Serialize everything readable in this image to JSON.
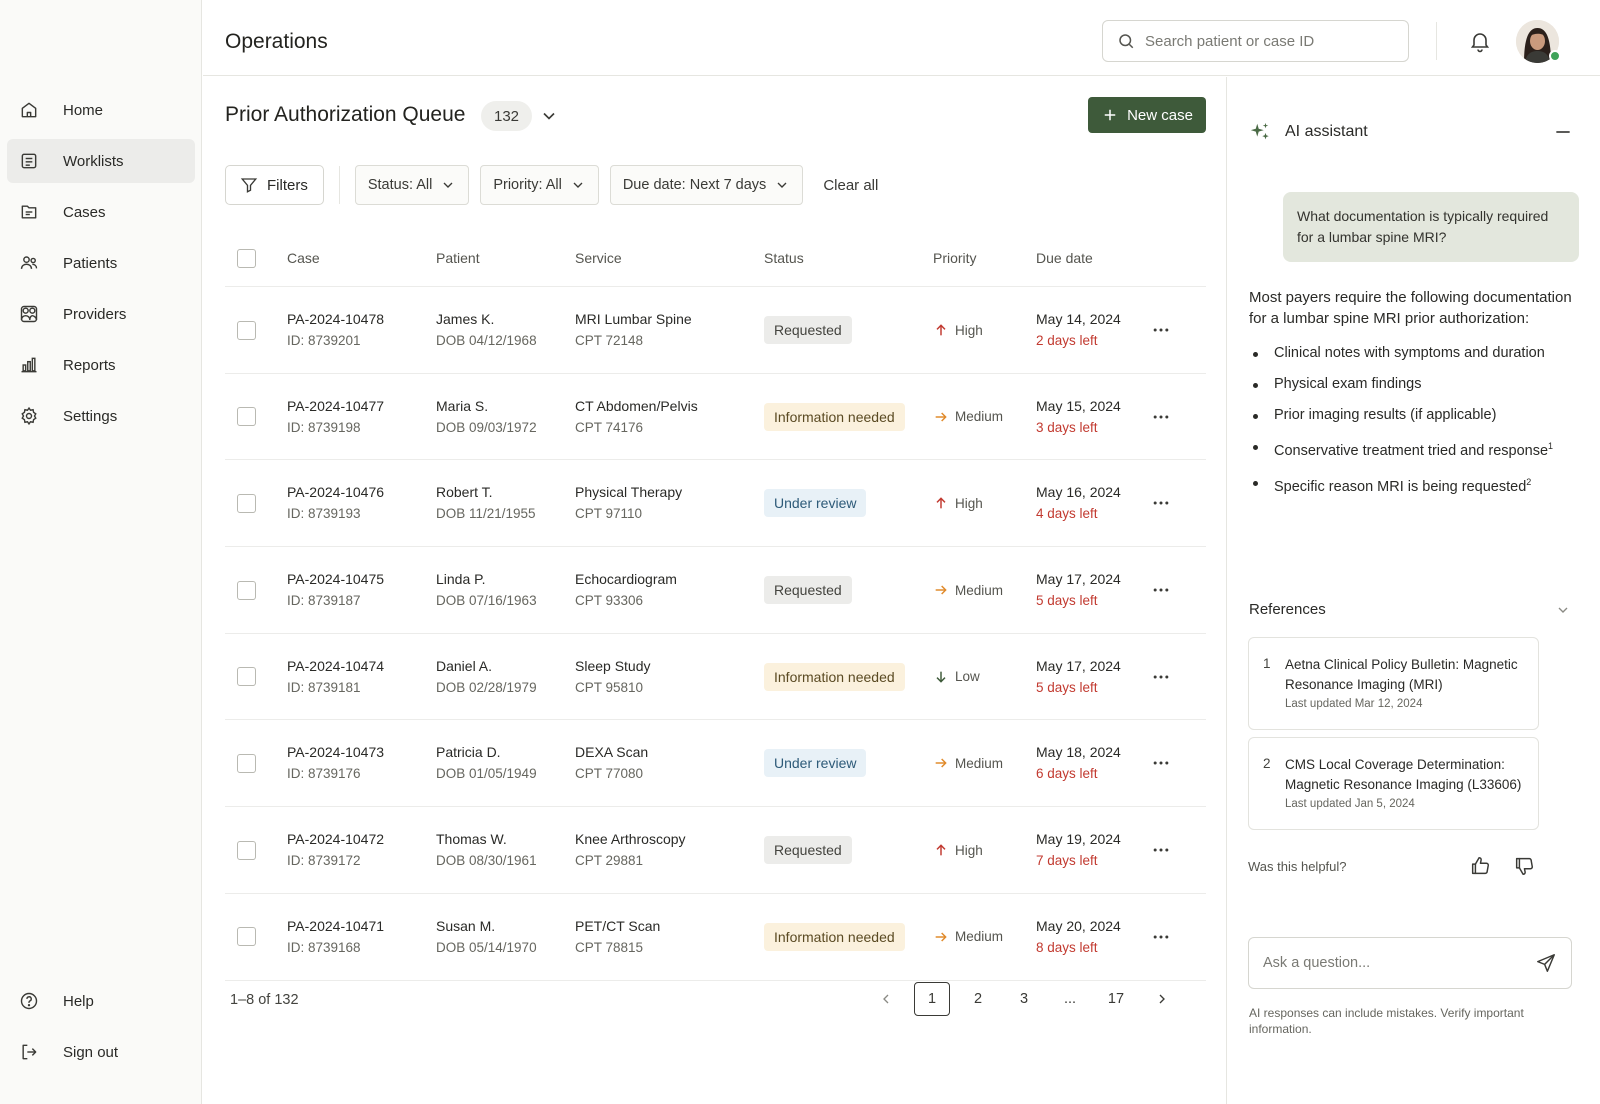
{
  "sidebar": {
    "items": [
      {
        "label": "Home",
        "icon": "home-icon"
      },
      {
        "label": "Worklists",
        "icon": "worklist-icon",
        "active": true
      },
      {
        "label": "Cases",
        "icon": "folder-icon"
      },
      {
        "label": "Patients",
        "icon": "users-icon"
      },
      {
        "label": "Providers",
        "icon": "providers-icon"
      },
      {
        "label": "Reports",
        "icon": "chart-icon"
      },
      {
        "label": "Settings",
        "icon": "gear-icon"
      }
    ],
    "bottom": [
      {
        "label": "Help",
        "icon": "help-icon"
      },
      {
        "label": "Sign out",
        "icon": "sign-out-icon"
      }
    ]
  },
  "header": {
    "title": "Operations",
    "search_placeholder": "Search patient or case ID"
  },
  "queue": {
    "title": "Prior Authorization Queue",
    "count": "132",
    "new_case_label": "New case"
  },
  "filters": {
    "filters_label": "Filters",
    "status": "Status: All",
    "priority": "Priority: All",
    "due_date": "Due date: Next 7 days",
    "clear_all": "Clear all"
  },
  "table": {
    "columns": [
      "Case",
      "Patient",
      "Service",
      "Status",
      "Priority",
      "Due date"
    ],
    "rows": [
      {
        "case": "PA-2024-10478",
        "id": "ID: 8739201",
        "patient": "James K.",
        "dob": "DOB 04/12/1968",
        "service": "MRI Lumbar Spine",
        "cpt": "CPT 72148",
        "status": "Requested",
        "status_type": "requested",
        "priority": "High",
        "priority_type": "high",
        "due": "May 14, 2024",
        "left": "2 days left"
      },
      {
        "case": "PA-2024-10477",
        "id": "ID: 8739198",
        "patient": "Maria S.",
        "dob": "DOB 09/03/1972",
        "service": "CT Abdomen/Pelvis",
        "cpt": "CPT 74176",
        "status": "Information needed",
        "status_type": "info",
        "priority": "Medium",
        "priority_type": "medium",
        "due": "May 15, 2024",
        "left": "3 days left"
      },
      {
        "case": "PA-2024-10476",
        "id": "ID: 8739193",
        "patient": "Robert T.",
        "dob": "DOB 11/21/1955",
        "service": "Physical Therapy",
        "cpt": "CPT 97110",
        "status": "Under review",
        "status_type": "review",
        "priority": "High",
        "priority_type": "high",
        "due": "May 16, 2024",
        "left": "4 days left"
      },
      {
        "case": "PA-2024-10475",
        "id": "ID: 8739187",
        "patient": "Linda P.",
        "dob": "DOB 07/16/1963",
        "service": "Echocardiogram",
        "cpt": "CPT 93306",
        "status": "Requested",
        "status_type": "requested",
        "priority": "Medium",
        "priority_type": "medium",
        "due": "May 17, 2024",
        "left": "5 days left"
      },
      {
        "case": "PA-2024-10474",
        "id": "ID: 8739181",
        "patient": "Daniel A.",
        "dob": "DOB 02/28/1979",
        "service": "Sleep Study",
        "cpt": "CPT 95810",
        "status": "Information needed",
        "status_type": "info",
        "priority": "Low",
        "priority_type": "low",
        "due": "May 17, 2024",
        "left": "5 days left"
      },
      {
        "case": "PA-2024-10473",
        "id": "ID: 8739176",
        "patient": "Patricia D.",
        "dob": "DOB 01/05/1949",
        "service": "DEXA Scan",
        "cpt": "CPT 77080",
        "status": "Under review",
        "status_type": "review",
        "priority": "Medium",
        "priority_type": "medium",
        "due": "May 18, 2024",
        "left": "6 days left"
      },
      {
        "case": "PA-2024-10472",
        "id": "ID: 8739172",
        "patient": "Thomas W.",
        "dob": "DOB 08/30/1961",
        "service": "Knee Arthroscopy",
        "cpt": "CPT 29881",
        "status": "Requested",
        "status_type": "requested",
        "priority": "High",
        "priority_type": "high",
        "due": "May 19, 2024",
        "left": "7 days left"
      },
      {
        "case": "PA-2024-10471",
        "id": "ID: 8739168",
        "patient": "Susan M.",
        "dob": "DOB 05/14/1970",
        "service": "PET/CT Scan",
        "cpt": "CPT 78815",
        "status": "Information needed",
        "status_type": "info",
        "priority": "Medium",
        "priority_type": "medium",
        "due": "May 20, 2024",
        "left": "8 days left"
      }
    ]
  },
  "pagination": {
    "summary": "1–8 of 132",
    "pages": [
      "1",
      "2",
      "3",
      "...",
      "17"
    ],
    "current": "1"
  },
  "assistant": {
    "title": "AI assistant",
    "question": "What documentation is typically required for a lumbar spine MRI?",
    "answer_intro": "Most payers require the following documentation for a lumbar spine MRI prior authorization:",
    "bullets": [
      {
        "text": "Clinical notes with symptoms and duration",
        "sup": ""
      },
      {
        "text": "Physical exam findings",
        "sup": ""
      },
      {
        "text": "Prior imaging results (if applicable)",
        "sup": ""
      },
      {
        "text": "Conservative treatment tried and response",
        "sup": "1"
      },
      {
        "text": "Specific reason MRI is being requested",
        "sup": "2"
      }
    ],
    "references_label": "References",
    "references": [
      {
        "num": "1",
        "title": "Aetna Clinical Policy Bulletin: Magnetic Resonance Imaging (MRI)",
        "date": "Last updated Mar 12, 2024"
      },
      {
        "num": "2",
        "title": "CMS Local Coverage Determination: Magnetic Resonance Imaging (L33606)",
        "date": "Last updated Jan 5, 2024"
      }
    ],
    "helpful_label": "Was this helpful?",
    "ask_placeholder": "Ask a question...",
    "disclaimer": "AI responses can include mistakes. Verify important information."
  },
  "colors": {
    "accent": "#3e5a3a",
    "danger": "#c23a30",
    "priority_high": "#c23a30",
    "priority_medium": "#e08a2a",
    "priority_low": "#3e5a3a"
  }
}
